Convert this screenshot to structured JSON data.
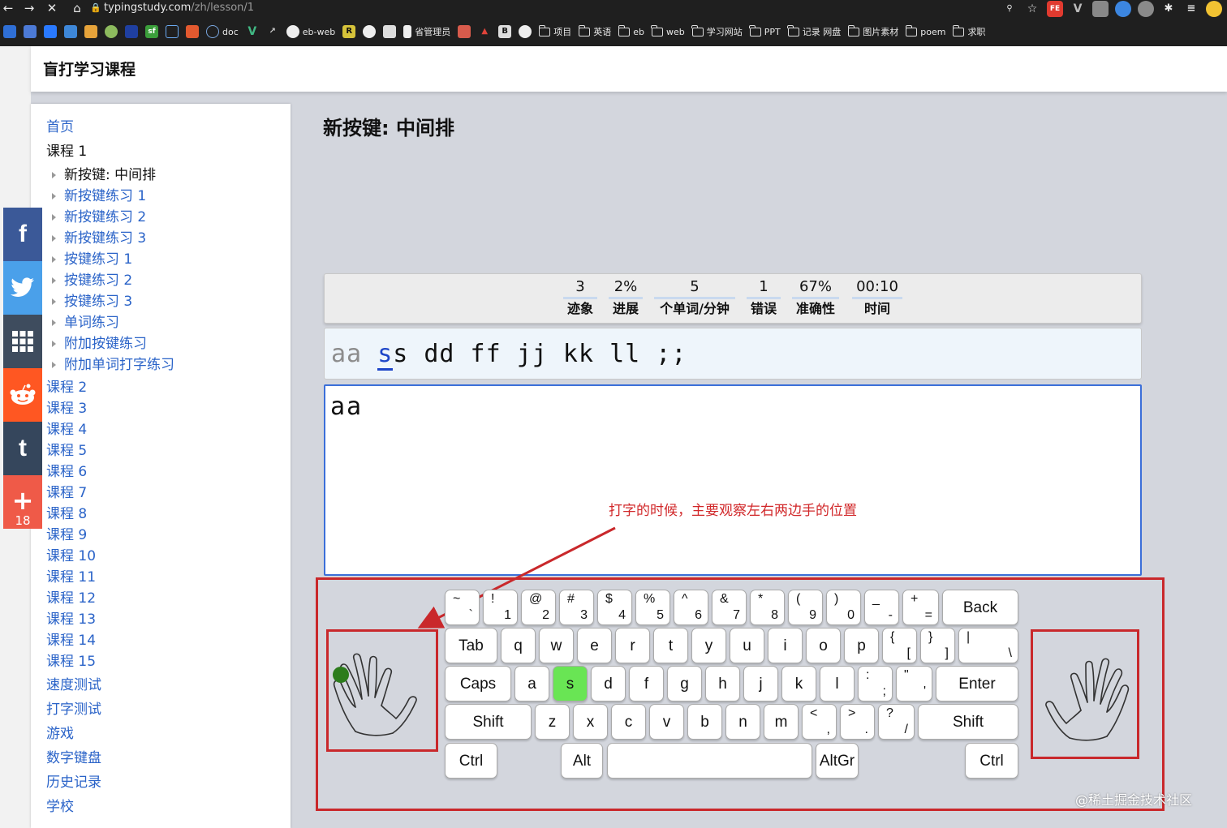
{
  "browser": {
    "url_domain": "typingstudy.com",
    "url_path": "/zh/lesson/1",
    "bookmarks": [
      "doc",
      "eb-web",
      "省管理员",
      "项目",
      "英语",
      "eb",
      "web",
      "学习网站",
      "PPT",
      "记录 网盘",
      "图片素材",
      "poem",
      "求职"
    ]
  },
  "site": {
    "title": "盲打学习课程"
  },
  "sidebar": {
    "home": "首页",
    "lesson1": "课程 1",
    "lesson1_items": [
      "新按键: 中间排",
      "新按键练习 1",
      "新按键练习 2",
      "新按键练习 3",
      "按键练习 1",
      "按键练习 2",
      "按键练习 3",
      "单词练习",
      "附加按键练习",
      "附加单词打字练习"
    ],
    "lessons": [
      "课程 2",
      "课程 3",
      "课程 4",
      "课程 5",
      "课程 6",
      "课程 7",
      "课程 8",
      "课程 9",
      "课程 10",
      "课程 11",
      "课程 12",
      "课程 13",
      "课程 14",
      "课程 15"
    ],
    "extras": [
      "速度测试",
      "打字测试",
      "游戏",
      "数字键盘",
      "历史记录",
      "学校"
    ]
  },
  "social": {
    "share_count": "18"
  },
  "lesson": {
    "title": "新按键: 中间排"
  },
  "stats": [
    {
      "value": "3",
      "label": "迹象"
    },
    {
      "value": "2%",
      "label": "进展"
    },
    {
      "value": "5",
      "label": "个单词/分钟"
    },
    {
      "value": "1",
      "label": "错误"
    },
    {
      "value": "67%",
      "label": "准确性"
    },
    {
      "value": "00:10",
      "label": "时间"
    }
  ],
  "exercise": {
    "done": "aa ",
    "current": "s",
    "rest": "s dd ff jj kk ll ;;",
    "typed": "aa"
  },
  "annotation": "打字的时候，主要观察左右两边手的位置",
  "keyboard": {
    "highlight_color": "#69e554",
    "rows": [
      [
        [
          "~",
          "`"
        ],
        [
          "!",
          "1"
        ],
        [
          "@",
          "2"
        ],
        [
          "#",
          "3"
        ],
        [
          "$",
          "4"
        ],
        [
          "%",
          "5"
        ],
        [
          "^",
          "6"
        ],
        [
          "&",
          "7"
        ],
        [
          "*",
          "8"
        ],
        [
          "(",
          "9"
        ],
        [
          ")",
          "0"
        ],
        [
          "_",
          "-"
        ],
        [
          "+",
          "="
        ],
        [
          "Back"
        ]
      ],
      [
        [
          "Tab"
        ],
        [
          "q"
        ],
        [
          "w"
        ],
        [
          "e"
        ],
        [
          "r"
        ],
        [
          "t"
        ],
        [
          "y"
        ],
        [
          "u"
        ],
        [
          "i"
        ],
        [
          "o"
        ],
        [
          "p"
        ],
        [
          "{",
          "["
        ],
        [
          "}",
          "]"
        ],
        [
          "|",
          "\\"
        ]
      ],
      [
        [
          "Caps"
        ],
        [
          "a"
        ],
        [
          "s"
        ],
        [
          "d"
        ],
        [
          "f"
        ],
        [
          "g"
        ],
        [
          "h"
        ],
        [
          "j"
        ],
        [
          "k"
        ],
        [
          "l"
        ],
        [
          ":",
          ";"
        ],
        [
          "\"",
          "'"
        ],
        [
          "Enter"
        ]
      ],
      [
        [
          "Shift"
        ],
        [
          "z"
        ],
        [
          "x"
        ],
        [
          "c"
        ],
        [
          "v"
        ],
        [
          "b"
        ],
        [
          "n"
        ],
        [
          "m"
        ],
        [
          "<",
          ","
        ],
        [
          ">",
          "."
        ],
        [
          "?",
          "/"
        ],
        [
          "Shift"
        ]
      ],
      [
        [
          "Ctrl"
        ],
        [
          "Alt"
        ],
        [
          " "
        ],
        [
          "AltGr"
        ],
        [
          "Ctrl"
        ]
      ]
    ],
    "active_key": "s"
  },
  "watermark": "@稀土掘金技术社区"
}
